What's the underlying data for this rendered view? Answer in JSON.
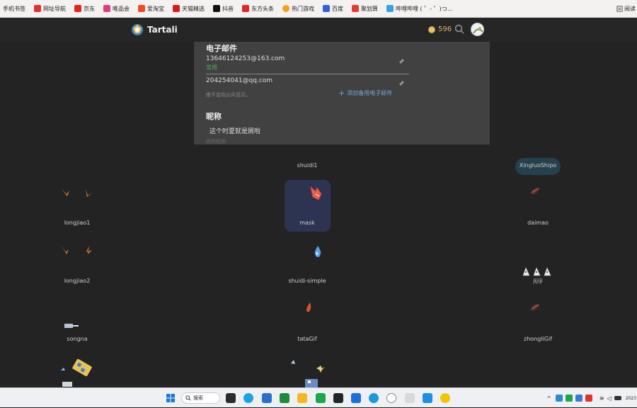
{
  "bookmarks": [
    {
      "label": "手机书签",
      "color": ""
    },
    {
      "label": "网址导航",
      "color": "#e0312c"
    },
    {
      "label": "京东",
      "color": "#e1251b"
    },
    {
      "label": "唯品会",
      "color": "#e23b7d"
    },
    {
      "label": "爱淘宝",
      "color": "#f04a24"
    },
    {
      "label": "天猫精选",
      "color": "#d81c1c"
    },
    {
      "label": "抖音",
      "color": "#111111"
    },
    {
      "label": "东方头条",
      "color": "#e02727"
    },
    {
      "label": "热门游戏",
      "color": "#f2a11a"
    },
    {
      "label": "百度",
      "color": "#3260d9"
    },
    {
      "label": "聚划算",
      "color": "#ea3a32"
    },
    {
      "label": "哔哩哔哩 ( ゜- ゜)つ...",
      "color": "#3aa3d9"
    }
  ],
  "bookmarks_read": "阅读",
  "header": {
    "logo_text": "Tartali",
    "coins": "596"
  },
  "panel": {
    "email_title": "电子邮件",
    "primary_email": "13646124253@163.com",
    "primary_tag": "常用",
    "backup_email": "204254041@qq.com",
    "privacy_note": "绝不会向公众显示。",
    "add_email": "添加备用电子邮件",
    "nickname_title": "昵称",
    "nickname_value": "这个时夏就是屑啦",
    "nickname_hint": "昵称昵称"
  },
  "stickers": [
    {
      "name": "shuidi1"
    },
    {
      "name": "XingluoShipo"
    },
    {
      "name": "longjiao1"
    },
    {
      "name": "mask"
    },
    {
      "name": "daimao"
    },
    {
      "name": "longjiao2"
    },
    {
      "name": "shuidi-simple"
    },
    {
      "name": "jijiji"
    },
    {
      "name": "songna"
    },
    {
      "name": "tataGif"
    },
    {
      "name": "zhongliGif"
    }
  ],
  "taskbar": {
    "search_label": "搜索",
    "clock": "2023"
  },
  "colors": {
    "page_bg": "#232323",
    "panel_bg": "#414141",
    "accent_green": "#4caf50",
    "accent_blue": "#6ea7d8",
    "coin": "#e0b664"
  }
}
